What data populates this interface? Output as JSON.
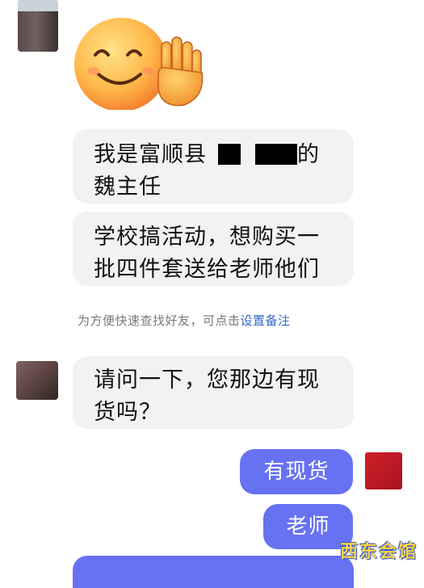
{
  "chat": {
    "messages_in": [
      {
        "text": "我是富顺县",
        "after_censor": "的",
        "line2": "魏主任"
      },
      {
        "line1": "学校搞活动，想购买一",
        "line2": "批四件套送给老师他们"
      },
      {
        "line1": "请问一下，您那边有现",
        "line2": "货吗？"
      }
    ],
    "hint": {
      "text": "为方便快速查找好友，可点击",
      "link": "设置备注"
    },
    "messages_out": [
      "有现货",
      "老师"
    ]
  },
  "icons": {
    "emoji": "smiling-face-waving-hand-icon"
  },
  "colors": {
    "outgoing_bubble": "#6772f3",
    "incoming_bubble": "#f1f2f4",
    "link": "#2e67c8"
  },
  "watermark": "西东会馆"
}
